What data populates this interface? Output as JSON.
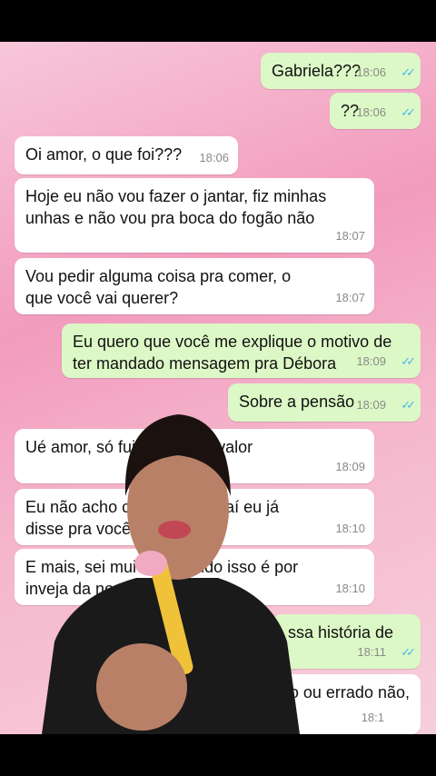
{
  "messages": [
    {
      "dir": "out",
      "text": "Gabriela???",
      "time": "18:06",
      "ticks": "✓✓"
    },
    {
      "dir": "out",
      "text": "??",
      "time": "18:06",
      "ticks": "✓✓"
    },
    {
      "dir": "in",
      "text": "Oi amor, o que foi???",
      "time": "18:06"
    },
    {
      "dir": "in",
      "text": "Hoje eu não vou fazer o jantar, fiz minhas unhas e não vou pra boca do fogão não",
      "time": "18:07"
    },
    {
      "dir": "in",
      "text": "Vou pedir alguma coisa pra comer, o que você vai querer?",
      "time": "18:07"
    },
    {
      "dir": "out",
      "text": "Eu quero que você me explique o motivo de ter mandado mensagem pra Débora",
      "time": "18:09",
      "ticks": "✓✓"
    },
    {
      "dir": "out",
      "text": "Sobre a pensão",
      "time": "18:09",
      "ticks": "✓✓"
    },
    {
      "dir": "in",
      "text": "Ué amor, só fui ... sobre o valor",
      "time": "18:09"
    },
    {
      "dir": "in",
      "text": "Eu não acho c ... final, isso aí eu já disse pra você",
      "time": "18:10"
    },
    {
      "dir": "in",
      "text": "E mais, sei mui ... que tudo isso é por inveja da no",
      "time": "18:10"
    },
    {
      "dir": "out",
      "text": "ssa história de",
      "time": "18:11",
      "ticks": "✓✓"
    },
    {
      "dir": "in",
      "text": "o ou errado não,",
      "time": "18:1"
    }
  ],
  "scroll_icon": "chevron-double-down",
  "colors": {
    "outgoing": "#dcf8c6",
    "incoming": "#ffffff",
    "ticks": "#4fb6ec",
    "timestamp": "#8a8a8a"
  }
}
